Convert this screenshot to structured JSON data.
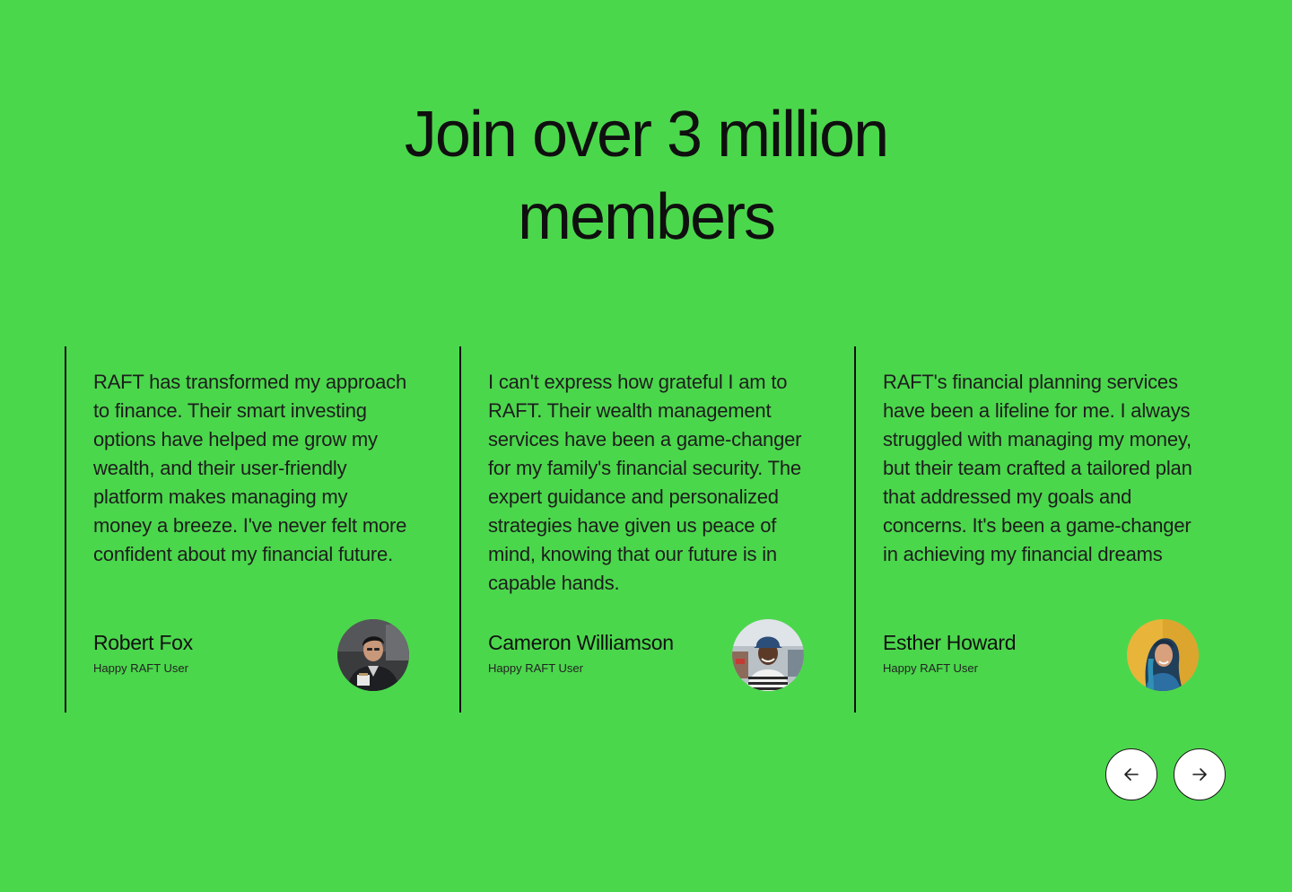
{
  "headline": "Join over 3 million members",
  "testimonials": [
    {
      "quote": "RAFT has transformed my approach to finance. Their smart investing options have helped me grow my wealth, and their user-friendly platform makes managing my money a breeze. I've never felt more confident about my financial future.",
      "name": "Robert Fox",
      "role": "Happy RAFT User"
    },
    {
      "quote": "I can't express how grateful I am to RAFT. Their wealth management services have been a game-changer for my family's financial security. The expert guidance and personalized strategies have given us peace of mind, knowing that our future is in capable hands.",
      "name": "Cameron Williamson",
      "role": "Happy RAFT User"
    },
    {
      "quote": "RAFT's financial planning services have been a lifeline for me. I always struggled with managing my money, but their team crafted a tailored plan that addressed my goals and concerns. It's been a game-changer in achieving my financial dreams",
      "name": "Esther Howard",
      "role": "Happy RAFT User"
    }
  ],
  "navigation": {
    "prev_icon": "arrow-left-icon",
    "next_icon": "arrow-right-icon"
  },
  "colors": {
    "background": "#4bd74c",
    "text": "#111111",
    "button_bg": "#ffffff"
  }
}
